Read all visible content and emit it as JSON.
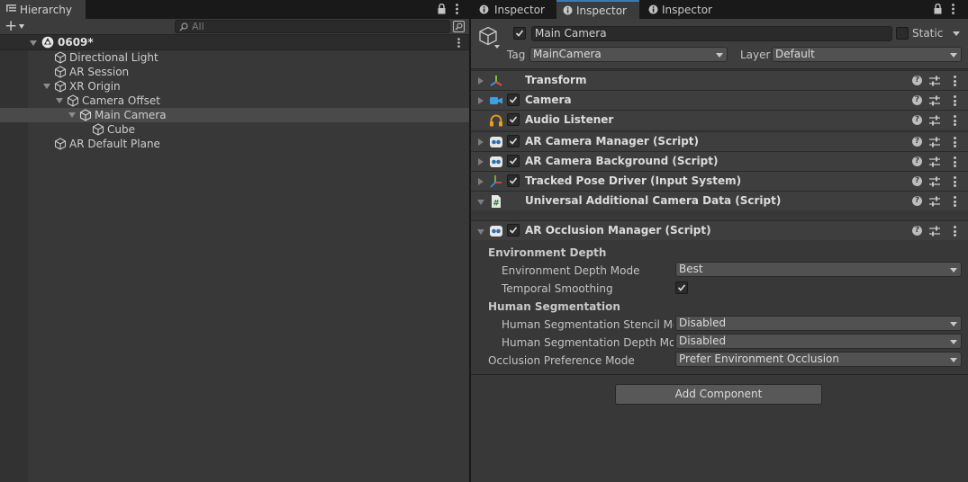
{
  "hierarchy": {
    "tab_label": "Hierarchy",
    "add_label": "+",
    "search_placeholder": "All",
    "scene_name": "0609*",
    "nodes": [
      {
        "label": "Directional Light",
        "icon": "cube-icon"
      },
      {
        "label": "AR Session",
        "icon": "cube-icon"
      },
      {
        "label": "XR Origin",
        "icon": "cube-icon"
      },
      {
        "label": "Camera Offset",
        "icon": "cube-icon"
      },
      {
        "label": "Main Camera",
        "icon": "cube-icon"
      },
      {
        "label": "Cube",
        "icon": "cube-icon"
      },
      {
        "label": "AR Default Plane",
        "icon": "cube-icon"
      }
    ]
  },
  "inspector": {
    "tabs": [
      {
        "label": "Inspector"
      },
      {
        "label": "Inspector"
      },
      {
        "label": "Inspector"
      }
    ],
    "object": {
      "name": "Main Camera",
      "active": true,
      "static_label": "Static",
      "tag_label": "Tag",
      "tag_value": "MainCamera",
      "layer_label": "Layer",
      "layer_value": "Default"
    },
    "components": [
      {
        "title": "Transform",
        "icon": "transform-icon",
        "has_checkbox": false,
        "expanded": false
      },
      {
        "title": "Camera",
        "icon": "camera-icon",
        "has_checkbox": true,
        "expanded": false
      },
      {
        "title": "Audio Listener",
        "icon": "headphones-icon",
        "has_checkbox": true,
        "expanded": false
      },
      {
        "title": "AR Camera Manager (Script)",
        "icon": "ar-script-icon",
        "has_checkbox": true,
        "expanded": false
      },
      {
        "title": "AR Camera Background (Script)",
        "icon": "ar-script-icon",
        "has_checkbox": true,
        "expanded": false
      },
      {
        "title": "Tracked Pose Driver (Input System)",
        "icon": "axes-icon",
        "has_checkbox": true,
        "expanded": false
      },
      {
        "title": "Universal Additional Camera Data (Script)",
        "icon": "csharp-script-icon",
        "has_checkbox": false,
        "expanded": true
      },
      {
        "title": "AR Occlusion Manager (Script)",
        "icon": "ar-script-icon",
        "has_checkbox": true,
        "expanded": true
      }
    ],
    "occlusion": {
      "env_section": "Environment Depth",
      "env_depth_mode_label": "Environment Depth Mode",
      "env_depth_mode_value": "Best",
      "temporal_smoothing_label": "Temporal Smoothing",
      "temporal_smoothing": true,
      "human_section": "Human Segmentation",
      "stencil_label": "Human Segmentation Stencil Mod",
      "stencil_value": "Disabled",
      "depth_label": "Human Segmentation Depth Mode",
      "depth_value": "Disabled",
      "pref_label": "Occlusion Preference Mode",
      "pref_value": "Prefer Environment Occlusion"
    },
    "add_component_label": "Add Component"
  }
}
